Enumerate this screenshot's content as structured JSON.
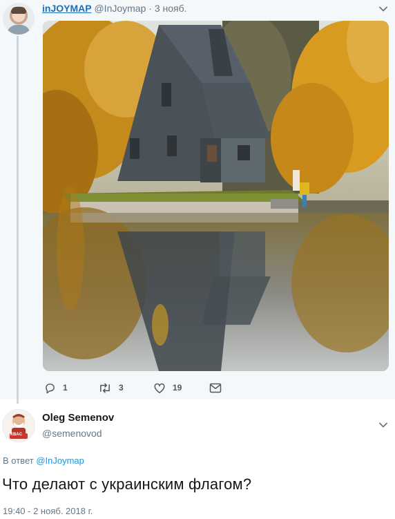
{
  "colors": {
    "link": "#1b95e0",
    "author": "#1b6fb8",
    "muted": "#657786",
    "thread_line": "#ccd6dd",
    "highlight_bg": "#f5f8fa"
  },
  "top_tweet": {
    "author_name": "inJOYMAP",
    "handle_date": "@InJoymap · 3 нояб.",
    "menu_icon": "chevron-down-icon",
    "image_subject": "wooden A-frame house by a lake in autumn",
    "actions": [
      {
        "icon": "reply-icon",
        "count": "1"
      },
      {
        "icon": "retweet-icon",
        "count": "3"
      },
      {
        "icon": "heart-icon",
        "count": "19"
      },
      {
        "icon": "message-icon",
        "count": ""
      }
    ]
  },
  "reply_tweet": {
    "author_name": "Oleg Semenov",
    "handle": "@semenovod",
    "avatar_badge": "КВАС",
    "reply_prefix": "В ответ",
    "reply_to_handle": "@InJoymap",
    "text": "Что делают с украинским флагом?",
    "timestamp": "19:40 - 2 нояб. 2018 г.",
    "menu_icon": "chevron-down-icon"
  }
}
